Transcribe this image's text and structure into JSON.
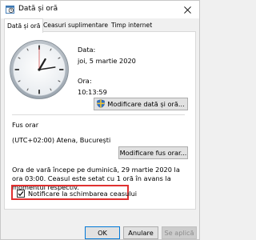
{
  "window": {
    "title": "Dată și oră"
  },
  "tabs": [
    {
      "label": "Dată și oră"
    },
    {
      "label": "Ceasuri suplimentare"
    },
    {
      "label": "Timp internet"
    }
  ],
  "date_section": {
    "date_label": "Data:",
    "date_value": "joi, 5 martie 2020",
    "time_label": "Ora:",
    "time_value": "10:13:59",
    "change_button": "Modificare dată și oră..."
  },
  "timezone_section": {
    "heading": "Fus orar",
    "value": "(UTC+02:00) Atena, București",
    "change_button": "Modificare fus orar..."
  },
  "dst_info": "Ora de vară începe pe duminică, 29 martie 2020 la ora 03:00. Ceasul este setat cu 1 oră în avans la momentul respectiv.",
  "notify": {
    "label": "Notificare la schimbarea ceasului",
    "checked": true
  },
  "footer": {
    "ok": "OK",
    "cancel": "Anulare",
    "apply": "Se aplică"
  },
  "icons": {
    "window": "clock-window-icon",
    "close": "close-icon",
    "shield": "uac-shield-icon",
    "check": "checkmark-icon"
  },
  "colors": {
    "accent": "#0078d7",
    "highlight": "#e03030"
  }
}
